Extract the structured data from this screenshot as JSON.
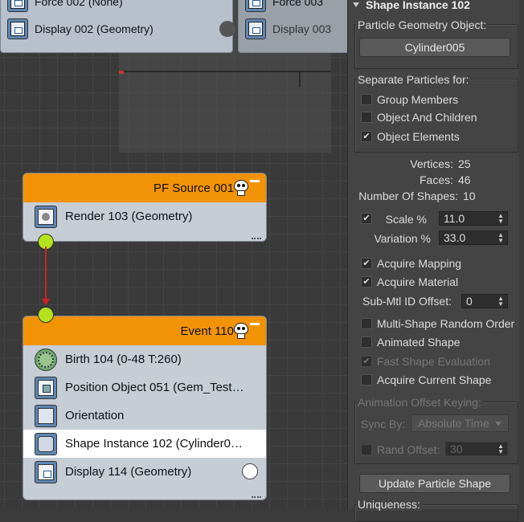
{
  "canvas": {
    "top_nodes": [
      {
        "label": "Force 002 (None)",
        "display": "Display 002 (Geometry)"
      },
      {
        "label": "Force 003",
        "display": "Display 003"
      }
    ],
    "source_node": {
      "title": "PF Source 001",
      "rows": [
        {
          "label": "Render 103 (Geometry)",
          "icon": "render-icon"
        }
      ]
    },
    "event_node": {
      "title": "Event 110",
      "rows": [
        {
          "label": "Birth 104 (0-48 T:260)",
          "icon": "birth-icon"
        },
        {
          "label": "Position Object 051 (Gem_Test…",
          "icon": "position-object-icon"
        },
        {
          "label": "Orientation",
          "icon": "orientation-icon"
        },
        {
          "label": "Shape Instance 102 (Cylinder0…",
          "icon": "shape-instance-icon",
          "selected": true
        },
        {
          "label": "Display 114 (Geometry)",
          "icon": "display-icon"
        }
      ]
    },
    "wire_color": "#d42020",
    "header_color": "#f29306",
    "port_color": "#b3e21c"
  },
  "panel": {
    "title": "Shape Instance 102",
    "geometry_group": {
      "label": "Particle Geometry Object:",
      "button": "Cylinder005"
    },
    "separate_group": {
      "label": "Separate Particles for:",
      "options": [
        {
          "label": "Group Members",
          "checked": false
        },
        {
          "label": "Object And Children",
          "checked": false
        },
        {
          "label": "Object Elements",
          "checked": true
        }
      ]
    },
    "stats": {
      "vertices_label": "Vertices:",
      "vertices": "25",
      "faces_label": "Faces:",
      "faces": "46",
      "shapes_label": "Number Of Shapes:",
      "shapes": "10"
    },
    "scale": {
      "label": "Scale %",
      "value": "11.0",
      "checked": true
    },
    "variation": {
      "label": "Variation %",
      "value": "33.0"
    },
    "acquire_mapping": {
      "label": "Acquire Mapping",
      "checked": true
    },
    "acquire_material": {
      "label": "Acquire Material",
      "checked": true
    },
    "submtl": {
      "label": "Sub-Mtl ID Offset:",
      "value": "0"
    },
    "multi_shape": {
      "label": "Multi-Shape Random Order",
      "checked": false
    },
    "animated_shape": {
      "label": "Animated Shape",
      "checked": false
    },
    "fast_shape": {
      "label": "Fast Shape Evaluation",
      "checked": true,
      "disabled": true
    },
    "acquire_current": {
      "label": "Acquire Current Shape",
      "checked": false
    },
    "anim_offset_group": {
      "label": "Animation Offset Keying:",
      "sync_label": "Sync By:",
      "sync_value": "Absolute Time",
      "rand_label": "Rand Offset:",
      "rand_value": "30"
    },
    "update_button": "Update Particle Shape",
    "uniqueness_label": "Uniqueness:"
  }
}
